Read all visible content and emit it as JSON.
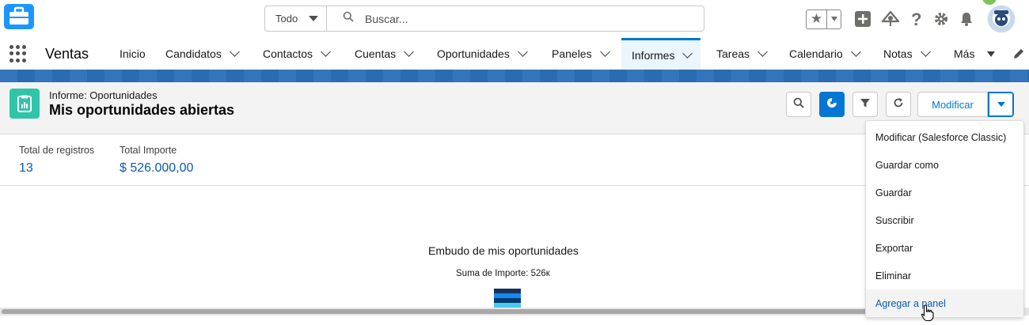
{
  "header": {
    "search_scope": "Todo",
    "search_placeholder": "Buscar..."
  },
  "nav": {
    "app_name": "Ventas",
    "items": [
      {
        "label": "Inicio"
      },
      {
        "label": "Candidatos"
      },
      {
        "label": "Contactos"
      },
      {
        "label": "Cuentas"
      },
      {
        "label": "Oportunidades"
      },
      {
        "label": "Paneles"
      },
      {
        "label": "Informes",
        "active": true
      },
      {
        "label": "Tareas"
      },
      {
        "label": "Calendario"
      },
      {
        "label": "Notas"
      },
      {
        "label": "Más"
      }
    ]
  },
  "report": {
    "breadcrumb": "Informe: Oportunidades",
    "title": "Mis oportunidades abiertas",
    "modify_label": "Modificar",
    "summary": [
      {
        "label": "Total de registros",
        "value": "13"
      },
      {
        "label": "Total Importe",
        "value": "$ 526.000,00"
      }
    ],
    "chart_title": "Embudo de mis oportunidades",
    "chart_subtitle": "Suma de Importe: 526к"
  },
  "menu": {
    "items": [
      {
        "label": "Modificar (Salesforce Classic)"
      },
      {
        "label": "Guardar como"
      },
      {
        "label": "Guardar"
      },
      {
        "label": "Suscribir"
      },
      {
        "label": "Exportar"
      },
      {
        "label": "Eliminar"
      },
      {
        "label": "Agregar a panel",
        "hovered": true
      }
    ]
  },
  "colors": {
    "brand": "#0176d3",
    "report_icon": "#2ec5a8",
    "band": "#2c6fb8",
    "funnel": [
      "#16325c",
      "#1589ee",
      "#00396b",
      "#4bc9f0"
    ]
  }
}
